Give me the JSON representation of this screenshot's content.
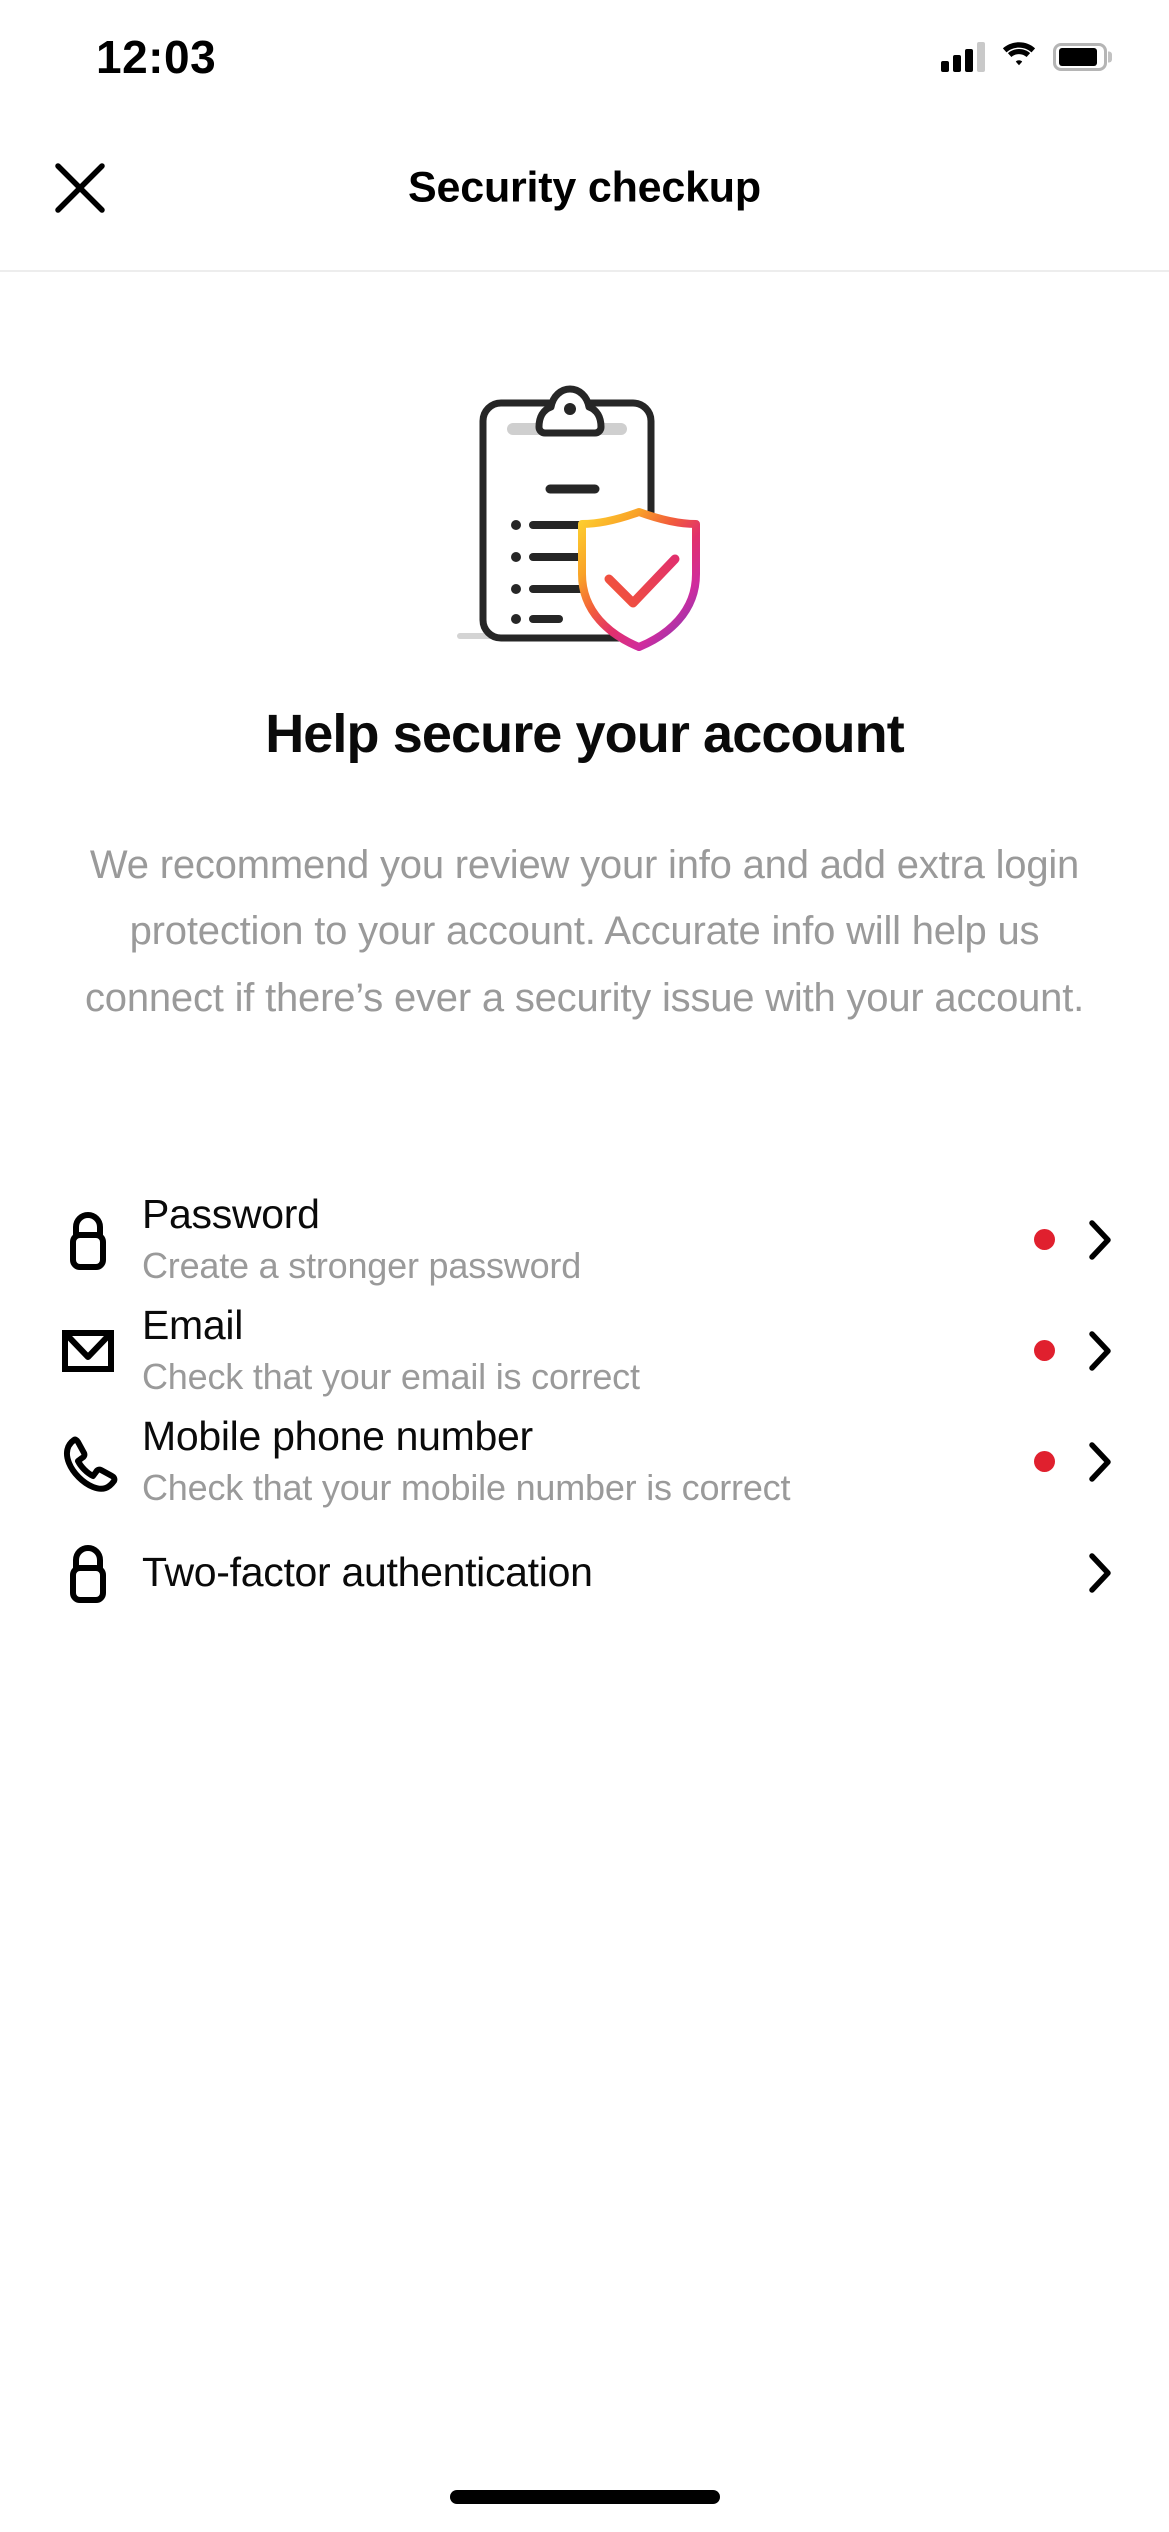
{
  "status_bar": {
    "time": "12:03",
    "cellular_icon": "cellular-signal-icon",
    "cellular_bars_filled": 3,
    "cellular_bars_total": 4,
    "wifi_icon": "wifi-icon",
    "battery_icon": "battery-full-icon"
  },
  "header": {
    "close_icon": "close-icon",
    "title": "Security checkup"
  },
  "hero": {
    "illustration_icon": "clipboard-shield-check-illustration",
    "headline": "Help secure your account",
    "description": "We recommend you review your info and add extra login protection to your account. Accurate info will help us connect if there’s ever a security issue with your account."
  },
  "checklist": {
    "items": [
      {
        "icon": "lock-icon",
        "title": "Password",
        "subtitle": "Create a stronger password",
        "badge": true,
        "chevron_icon": "chevron-right-icon"
      },
      {
        "icon": "envelope-icon",
        "title": "Email",
        "subtitle": "Check that your email is correct",
        "badge": true,
        "chevron_icon": "chevron-right-icon"
      },
      {
        "icon": "phone-icon",
        "title": "Mobile phone number",
        "subtitle": "Check that your mobile number is correct",
        "badge": true,
        "chevron_icon": "chevron-right-icon"
      },
      {
        "icon": "lock-icon",
        "title": "Two-factor authentication",
        "subtitle": "",
        "badge": false,
        "chevron_icon": "chevron-right-icon"
      }
    ]
  },
  "colors": {
    "badge_red": "#E0202E",
    "text_primary": "#0A0A0A",
    "text_secondary": "#9A9A9A",
    "divider": "#EDEDED",
    "gradient_yellow": "#FDCB2F",
    "gradient_orange": "#F58529",
    "gradient_pink": "#E1306C",
    "gradient_magenta": "#C13584",
    "gradient_purple": "#833AB4",
    "illustration_dark": "#262626",
    "background": "#FFFFFF"
  },
  "home_indicator": "home-indicator-bar"
}
